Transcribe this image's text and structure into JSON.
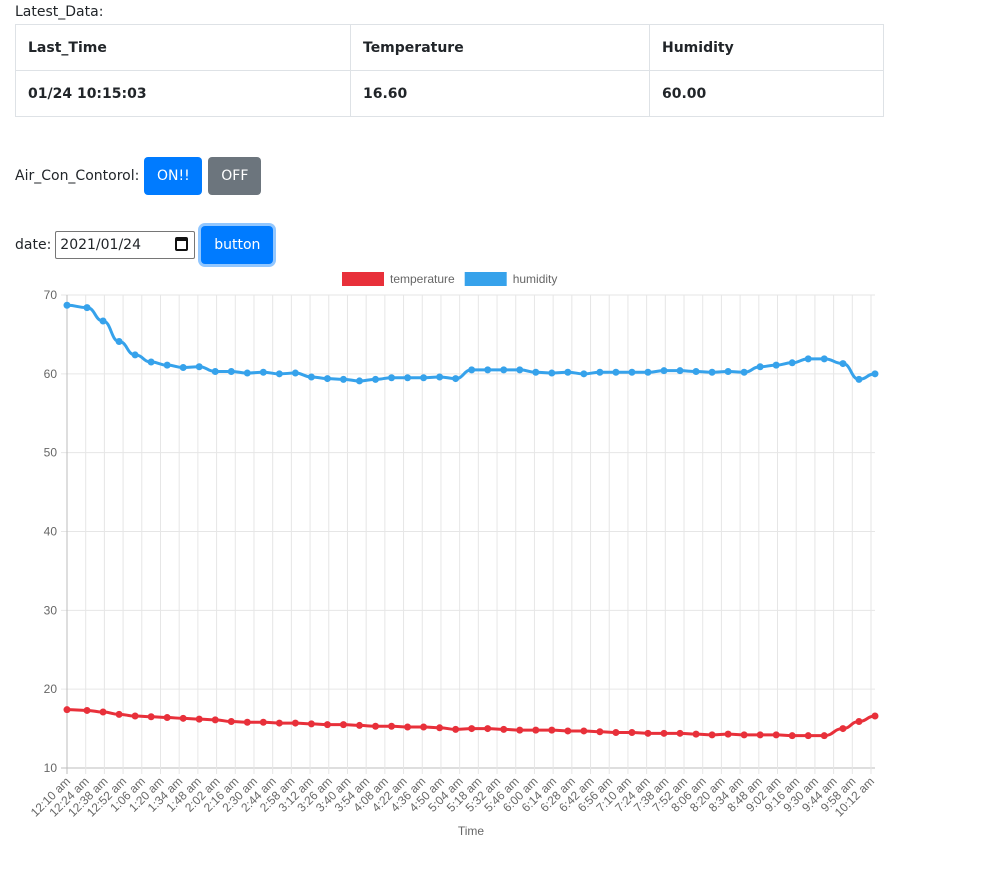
{
  "latest": {
    "title": "Latest_Data:",
    "headers": [
      "Last_Time",
      "Temperature",
      "Humidity"
    ],
    "row": [
      "01/24 10:15:03",
      "16.60",
      "60.00"
    ]
  },
  "aircon": {
    "label": "Air_Con_Contorol:",
    "on_label": "ON!!",
    "off_label": "OFF"
  },
  "date_form": {
    "label": "date:",
    "value": "2021/01/24",
    "button_label": "button"
  },
  "colors": {
    "primary": "#007bff",
    "secondary": "#6c757d",
    "temperature": "#e8303a",
    "humidity": "#36a2eb"
  },
  "chart_data": {
    "type": "line",
    "title": "",
    "xlabel": "Time",
    "ylabel": "",
    "ylim": [
      10,
      70
    ],
    "yticks": [
      10,
      20,
      30,
      40,
      50,
      60,
      70
    ],
    "grid": true,
    "legend": "top-center",
    "x_tick_labels": [
      "12:10 am",
      "12:24 am",
      "12:38 am",
      "12:52 am",
      "1:06 am",
      "1:20 am",
      "1:34 am",
      "1:48 am",
      "2:02 am",
      "2:16 am",
      "2:30 am",
      "2:44 am",
      "2:58 am",
      "3:12 am",
      "3:26 am",
      "3:40 am",
      "3:54 am",
      "4:08 am",
      "4:22 am",
      "4:36 am",
      "4:50 am",
      "5:04 am",
      "5:18 am",
      "5:32 am",
      "5:46 am",
      "6:00 am",
      "6:14 am",
      "6:28 am",
      "6:42 am",
      "6:56 am",
      "7:10 am",
      "7:24 am",
      "7:38 am",
      "7:52 am",
      "8:06 am",
      "8:20 am",
      "8:34 am",
      "8:48 am",
      "9:02 am",
      "9:16 am",
      "9:30 am",
      "9:44 am",
      "9:58 am",
      "10:12 am"
    ],
    "x_minutes": [
      10,
      25,
      37,
      49,
      61,
      73,
      85,
      97,
      109,
      121,
      133,
      145,
      157,
      169,
      181,
      193,
      205,
      217,
      229,
      241,
      253,
      265,
      277,
      289,
      301,
      313,
      325,
      337,
      349,
      361,
      373,
      385,
      397,
      409,
      421,
      433,
      445,
      457,
      469,
      481,
      493,
      505,
      517,
      529,
      541,
      553,
      565,
      577,
      591,
      603,
      615
    ],
    "series": [
      {
        "name": "temperature",
        "values": [
          17.4,
          17.3,
          17.1,
          16.8,
          16.6,
          16.5,
          16.4,
          16.3,
          16.2,
          16.1,
          15.9,
          15.8,
          15.8,
          15.7,
          15.7,
          15.6,
          15.5,
          15.5,
          15.4,
          15.3,
          15.3,
          15.2,
          15.2,
          15.1,
          14.9,
          15.0,
          15.0,
          14.9,
          14.8,
          14.8,
          14.8,
          14.7,
          14.7,
          14.6,
          14.5,
          14.5,
          14.4,
          14.4,
          14.4,
          14.3,
          14.2,
          14.3,
          14.2,
          14.2,
          14.2,
          14.1,
          14.1,
          14.1,
          15.0,
          15.9,
          16.6
        ]
      },
      {
        "name": "humidity",
        "values": [
          68.7,
          68.4,
          66.7,
          64.1,
          62.4,
          61.5,
          61.1,
          60.8,
          60.9,
          60.3,
          60.3,
          60.1,
          60.2,
          60.0,
          60.1,
          59.6,
          59.4,
          59.3,
          59.1,
          59.3,
          59.5,
          59.5,
          59.5,
          59.6,
          59.4,
          60.5,
          60.5,
          60.5,
          60.5,
          60.2,
          60.1,
          60.2,
          60.0,
          60.2,
          60.2,
          60.2,
          60.2,
          60.4,
          60.4,
          60.3,
          60.2,
          60.3,
          60.2,
          60.9,
          61.1,
          61.4,
          61.9,
          61.9,
          61.3,
          59.3,
          60.0
        ]
      }
    ]
  }
}
